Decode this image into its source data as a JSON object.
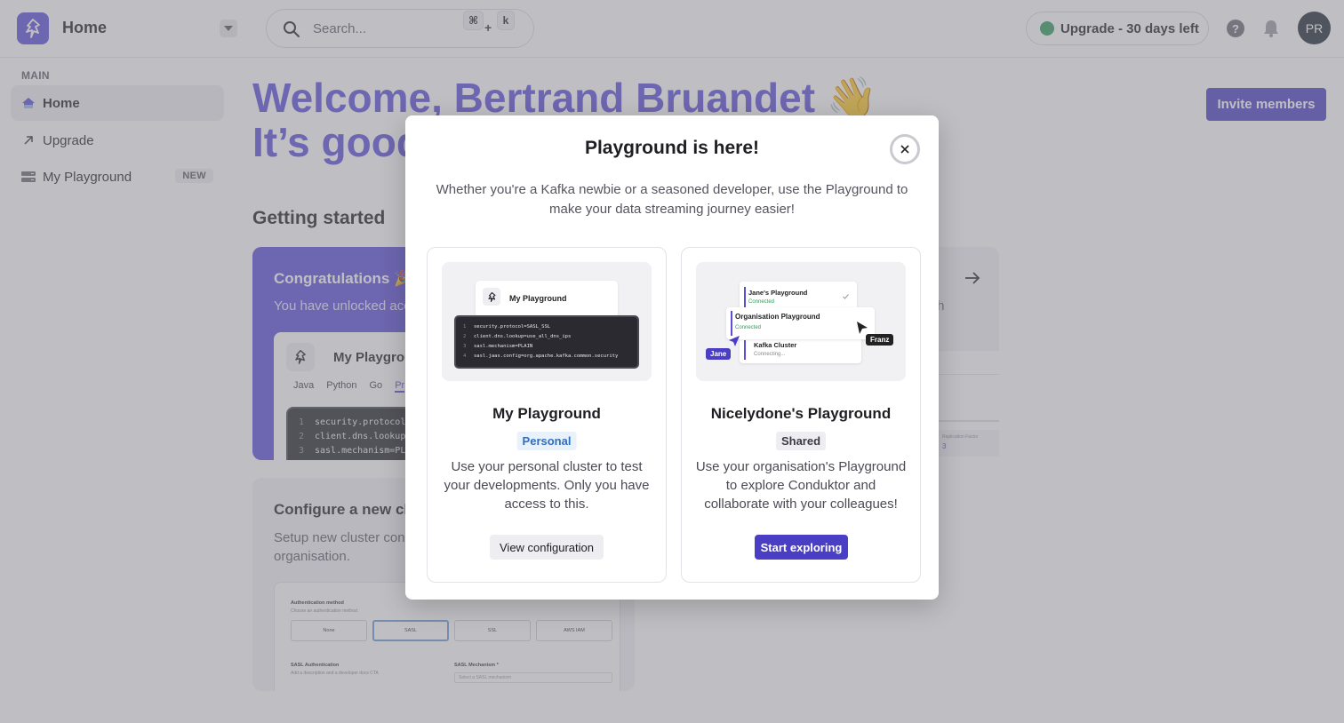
{
  "header": {
    "app_title": "Home",
    "search_placeholder": "Search...",
    "shortcut_key1": "⌘",
    "shortcut_plus": "+",
    "shortcut_key2": "k",
    "upgrade_label": "Upgrade - 30 days left",
    "help_label": "?",
    "avatar_initials": "PR"
  },
  "sidebar": {
    "section_label": "MAIN",
    "items": [
      {
        "label": "Home"
      },
      {
        "label": "Upgrade"
      },
      {
        "label": "My Playground",
        "badge": "NEW"
      }
    ]
  },
  "main": {
    "welcome_line1": "Welcome, Bertrand Bruandet 👋",
    "welcome_line2": "It’s good",
    "invite_label": "Invite members",
    "getting_started": "Getting started",
    "congrats_title": "Congratulations 🎉",
    "congrats_sub": "You have unlocked acc",
    "mini_title": "My Playgrou",
    "mini_tabs": [
      "Java",
      "Python",
      "Go",
      "Pr"
    ],
    "mini_code": [
      {
        "n": "1",
        "t": "security.protocol=S"
      },
      {
        "n": "2",
        "t": "client.dns.lookup=u"
      },
      {
        "n": "3",
        "t": "sasl.mechanism=PLAI"
      }
    ],
    "right_card_partial": "th",
    "right_mini_title": "Replication Factor",
    "right_mini_value": "3",
    "config_title": "Configure a new clu",
    "config_sub": "Setup new cluster con organisation.",
    "auth": {
      "method_title": "Authentication method",
      "method_sub": "Choose an authentication method.",
      "options": [
        "None",
        "SASL",
        "SSL",
        "AWS IAM"
      ],
      "sasl_auth_title": "SASL Authentication",
      "sasl_auth_sub": "Add a description and a developer docs CTA",
      "sasl_mech_title": "SASL Mechanism *",
      "sasl_mech_placeholder": "Select a SASL mechanism"
    }
  },
  "modal": {
    "title": "Playground is here!",
    "close_label": "×",
    "description": "Whether you're a Kafka newbie or a seasoned developer, use the Playground to make your data streaming journey easier!",
    "cards": [
      {
        "name": "My Playground",
        "tag": "Personal",
        "description": "Use your personal cluster to test your developments. Only you have access to this.",
        "button": "View configuration",
        "illus_title": "My Playground",
        "illus_code": [
          {
            "n": "1",
            "t": "security.protocol=SASL_SSL"
          },
          {
            "n": "2",
            "t": "client.dns.lookup=use_all_dns_ips"
          },
          {
            "n": "3",
            "t": "sasl.mechanism=PLAIN"
          },
          {
            "n": "4",
            "t": "sasl.jaas.config=org.apache.kafka.common.security"
          }
        ]
      },
      {
        "name": "Nicelydone's Playground",
        "tag": "Shared",
        "description": "Use your organisation's Playground to explore Conduktor and collaborate with your colleagues!",
        "button": "Start exploring",
        "illus_items": [
          {
            "name": "Jane's Playground",
            "status": "Connected"
          },
          {
            "name": "Organisation Playground",
            "status": "Connected"
          },
          {
            "name": "Kafka Cluster",
            "status": "Connecting..."
          }
        ],
        "illus_tag_left": "Jane",
        "illus_tag_right": "Franz"
      }
    ]
  },
  "colors": {
    "brand": "#5b4dd8",
    "primary_button": "#4a3fc4",
    "status_green": "#2f9a5a",
    "personal_tag": "#2f6fbf"
  }
}
